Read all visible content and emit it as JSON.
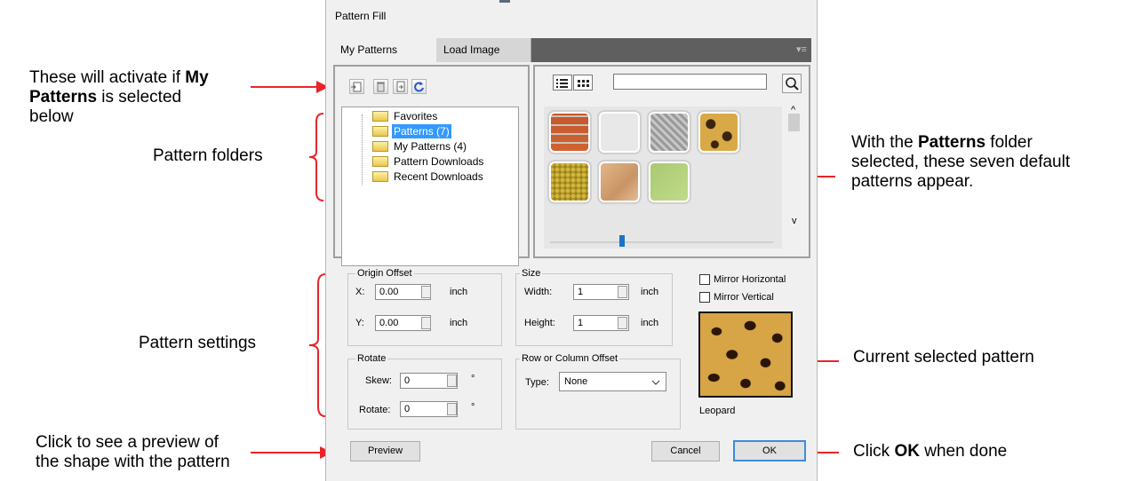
{
  "annotations": {
    "toolbar_note": {
      "line1_pre": "These will activate if ",
      "line1_bold": "My",
      "line2_bold": "Patterns",
      "line2_post": " is selected",
      "line3": "below"
    },
    "pattern_folders": "Pattern folders",
    "patterns_note": {
      "line1_pre": "With the ",
      "line1_bold": "Patterns",
      "line1_post": " folder",
      "line2": "selected, these seven default",
      "line3": "patterns appear."
    },
    "pattern_settings": "Pattern settings",
    "current_pattern": "Current selected pattern",
    "preview_note": {
      "line1": "Click to see a preview of",
      "line2": "the shape with the pattern"
    },
    "ok_note": {
      "pre": "Click ",
      "bold": "OK",
      "post": " when done"
    }
  },
  "dialog": {
    "title": "Pattern Fill",
    "tabs": [
      {
        "label": "My Patterns"
      },
      {
        "label": "Load Image"
      }
    ],
    "tab_menu_glyph": "▾≡",
    "folders": [
      {
        "label": "Favorites",
        "selected": false
      },
      {
        "label": "Patterns (7)",
        "selected": true
      },
      {
        "label": "My Patterns (4)",
        "selected": false
      },
      {
        "label": "Pattern Downloads",
        "selected": false
      },
      {
        "label": "Recent Downloads",
        "selected": false
      }
    ],
    "search": {
      "value": "",
      "icon": "search-icon"
    },
    "patterns": [
      "brick",
      "light-gray",
      "diamond-plate",
      "leopard",
      "yellow-scales",
      "stone",
      "green-paper"
    ],
    "scroll_glyphs": {
      "up": "^",
      "down": "v"
    },
    "zoom_slider_value": 0.33,
    "origin_offset": {
      "legend": "Origin Offset",
      "x_label": "X:",
      "x_value": "0.00",
      "y_label": "Y:",
      "y_value": "0.00",
      "unit": "inch"
    },
    "size": {
      "legend": "Size",
      "width_label": "Width:",
      "width_value": "1",
      "height_label": "Height:",
      "height_value": "1",
      "unit": "inch"
    },
    "mirror_horizontal": {
      "label": "Mirror Horizontal",
      "checked": false
    },
    "mirror_vertical": {
      "label": "Mirror Vertical",
      "checked": false
    },
    "rotate": {
      "legend": "Rotate",
      "skew_label": "Skew:",
      "skew_value": "0",
      "rotate_label": "Rotate:",
      "rotate_value": "0",
      "unit": "°"
    },
    "row_col_offset": {
      "legend": "Row or Column Offset",
      "type_label": "Type:",
      "type_value": "None"
    },
    "current_pattern_name": "Leopard",
    "buttons": {
      "preview": "Preview",
      "cancel": "Cancel",
      "ok": "OK"
    }
  }
}
